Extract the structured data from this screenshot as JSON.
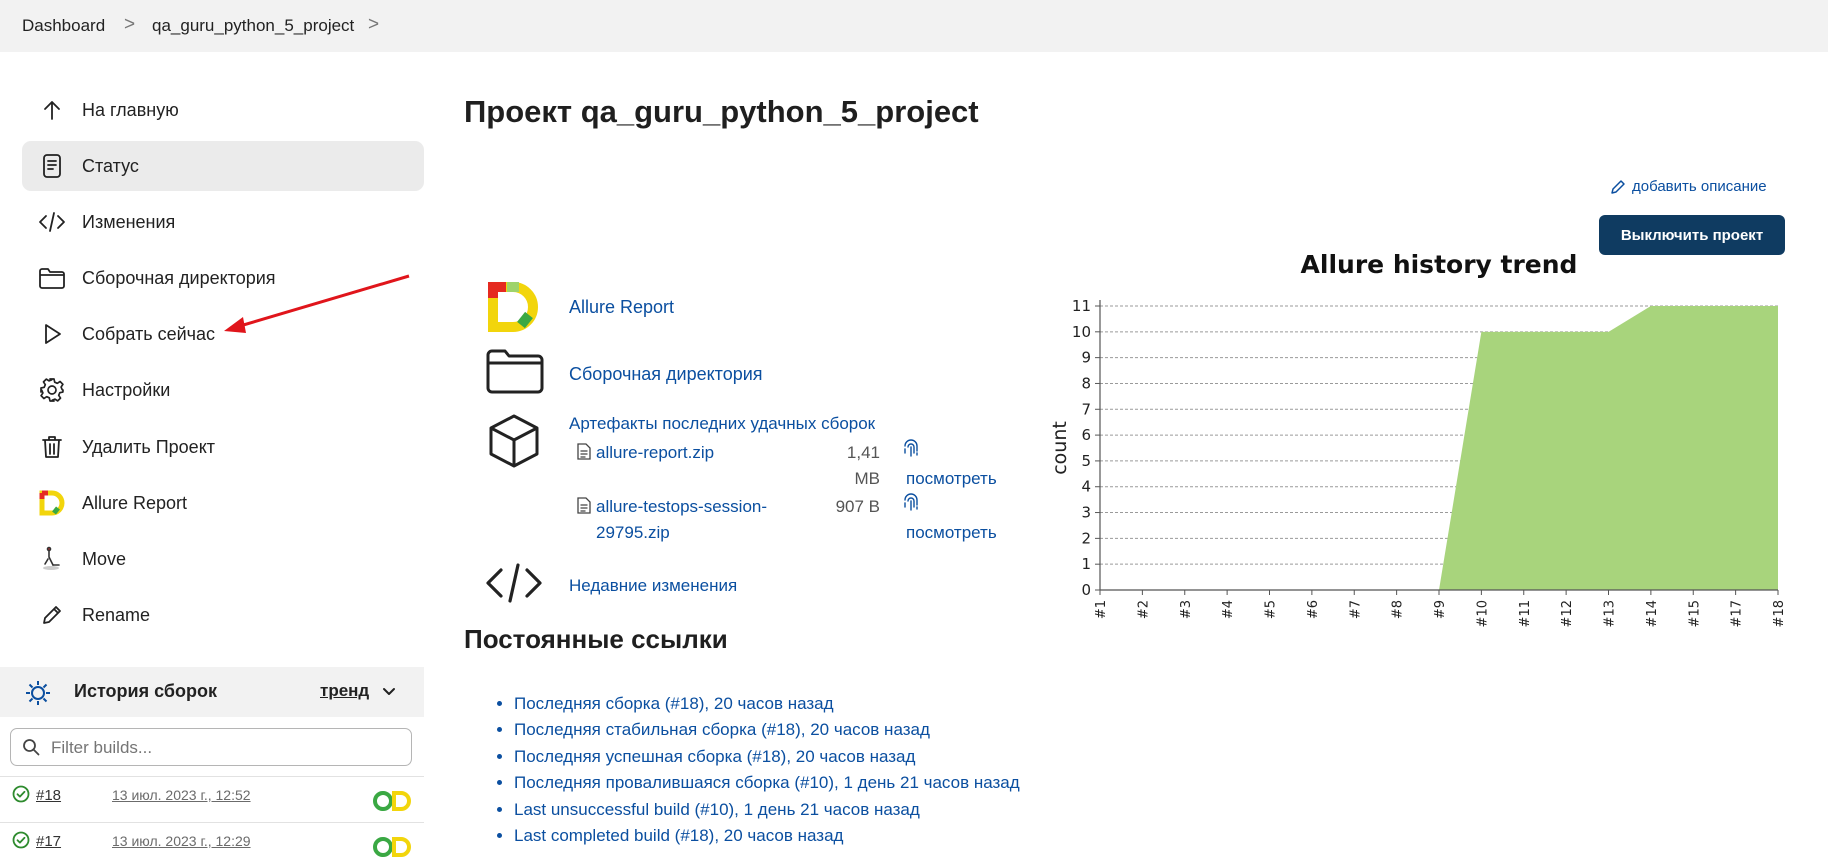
{
  "breadcrumb": {
    "items": [
      "Dashboard",
      "qa_guru_python_5_project"
    ],
    "separator": ">"
  },
  "sidebar": {
    "items": [
      {
        "label": "На главную",
        "icon": "arrow-up-icon"
      },
      {
        "label": "Статус",
        "icon": "document-icon",
        "active": true
      },
      {
        "label": "Изменения",
        "icon": "code-icon"
      },
      {
        "label": "Сборочная директория",
        "icon": "folder-icon"
      },
      {
        "label": "Собрать сейчас",
        "icon": "play-icon"
      },
      {
        "label": "Настройки",
        "icon": "gear-icon"
      },
      {
        "label": "Удалить Проект",
        "icon": "trash-icon"
      },
      {
        "label": "Allure Report",
        "icon": "allure-logo-icon"
      },
      {
        "label": "Move",
        "icon": "move-icon"
      },
      {
        "label": "Rename",
        "icon": "pencil-icon"
      }
    ]
  },
  "build_history": {
    "title": "История сборок",
    "trend_label": "тренд",
    "filter_placeholder": "Filter builds...",
    "builds": [
      {
        "number": "#18",
        "date": "13 июл. 2023 г., 12:52",
        "status": "success"
      },
      {
        "number": "#17",
        "date": "13 июл. 2023 г., 12:29",
        "status": "success"
      }
    ]
  },
  "main": {
    "title": "Проект qa_guru_python_5_project",
    "add_description": "добавить описание",
    "disable_button": "Выключить проект",
    "links": {
      "allure_report": "Allure Report",
      "workspace": "Сборочная директория",
      "artifacts_title": "Артефакты последних удачных сборок",
      "recent_changes": "Недавние изменения"
    },
    "artifacts": [
      {
        "name_line1": "allure-report.zip",
        "name_line2": "",
        "size_line1": "1,41",
        "size_line2": "MB",
        "view": "посмотреть"
      },
      {
        "name_line1": "allure-testops-session-",
        "name_line2": "29795.zip",
        "size_line1": "907 B",
        "size_line2": "",
        "view": "посмотреть"
      }
    ],
    "permalinks_title": "Постоянные ссылки",
    "permalinks": [
      "Последняя сборка (#18), 20 часов назад",
      "Последняя стабильная сборка (#18), 20 часов назад",
      "Последняя успешная сборка (#18), 20 часов назад",
      "Последняя провалившаяся сборка (#10), 1 день 21 часов назад",
      "Last unsuccessful build (#10), 1 день 21 часов назад",
      "Last completed build (#18), 20 часов назад"
    ]
  },
  "colors": {
    "accent_link": "#0b4fa0",
    "button_bg": "#0f3b61",
    "chart_fill": "#a8d47c",
    "annotation_arrow": "#e0151b",
    "success": "#2e8b2e"
  },
  "chart_data": {
    "type": "area",
    "title": "Allure history trend",
    "xlabel": "",
    "ylabel": "count",
    "x": [
      "#1",
      "#2",
      "#3",
      "#4",
      "#5",
      "#6",
      "#7",
      "#8",
      "#9",
      "#10",
      "#11",
      "#12",
      "#13",
      "#14",
      "#15",
      "#17",
      "#18"
    ],
    "series": [
      {
        "values": [
          0,
          0,
          0,
          0,
          0,
          0,
          0,
          0,
          0,
          10,
          10,
          10,
          10,
          11,
          11,
          11,
          11
        ]
      }
    ],
    "ylim": [
      0,
      11
    ],
    "yticks": [
      0,
      1,
      2,
      3,
      4,
      5,
      6,
      7,
      8,
      9,
      10,
      11
    ],
    "grid": "horizontal dashed",
    "legend": "none"
  }
}
